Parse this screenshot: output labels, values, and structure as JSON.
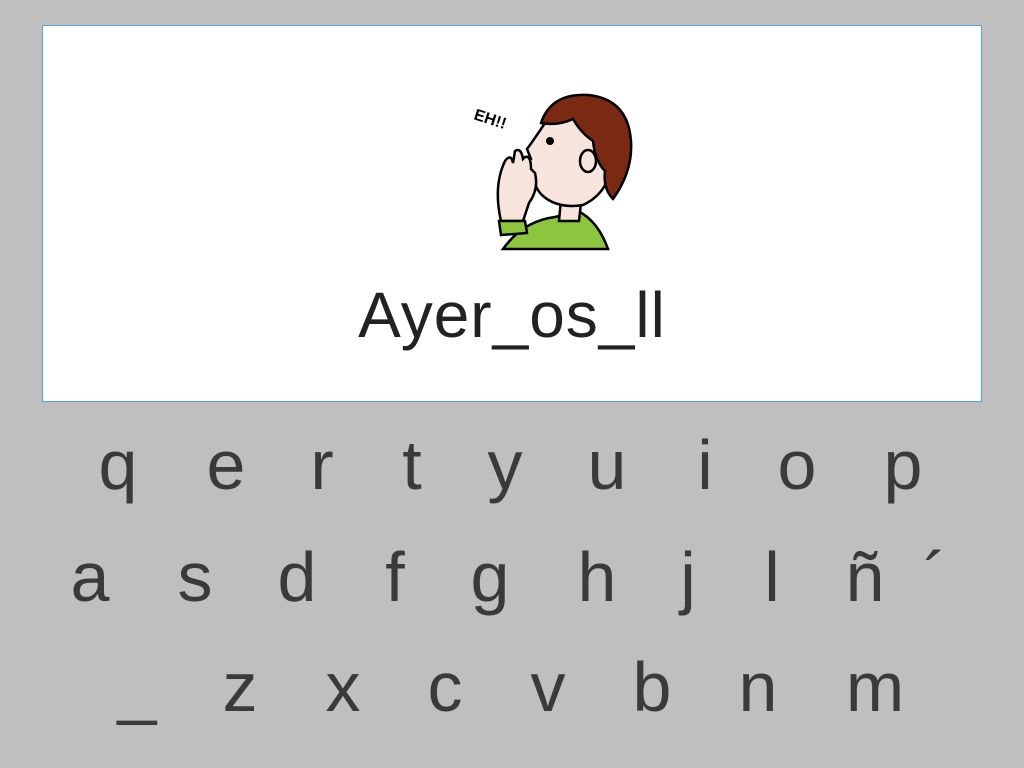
{
  "colors": {
    "background": "#bfbfbf",
    "card": "#ffffff",
    "card_border": "#4aa8d8",
    "key_text": "#3a3a3a"
  },
  "prompt": {
    "pictogram": "person-calling-out-icon",
    "pictogram_text": "EH!!",
    "word": "Ayer_os_ll"
  },
  "keyboard": {
    "row1": [
      "q",
      "e",
      "r",
      "t",
      "y",
      "u",
      "i",
      "o",
      "p"
    ],
    "row2": [
      "a",
      "s",
      "d",
      "f",
      "g",
      "h",
      "j",
      "l",
      "ñ",
      "´"
    ],
    "row3": [
      "_",
      "z",
      "x",
      "c",
      "v",
      "b",
      "n",
      "m"
    ]
  }
}
